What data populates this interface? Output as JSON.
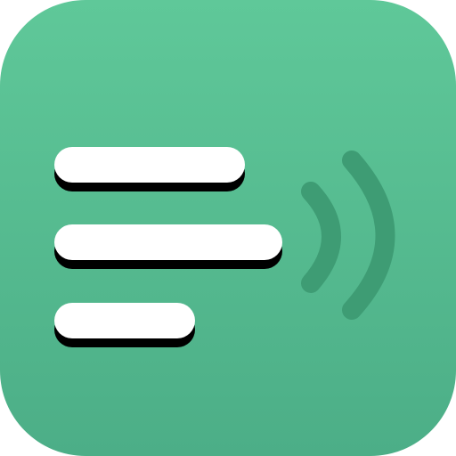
{
  "icon": {
    "name": "text-to-speech-app-icon",
    "background_top_color": "#5FC899",
    "background_bottom_color": "#4CAE87",
    "line_color": "#FFFFFF",
    "shadow_color": "#000000",
    "wave_color": "#3E9C74"
  }
}
